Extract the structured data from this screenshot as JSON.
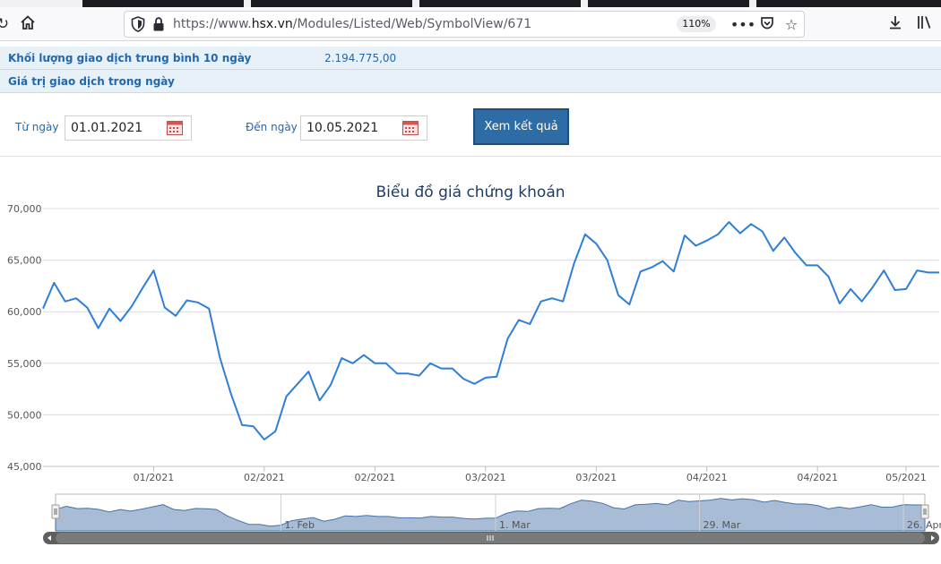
{
  "browser": {
    "url_prefix": "https://www.",
    "url_domain": "hsx.vn",
    "url_path": "/Modules/Listed/Web/SymbolView/671",
    "zoom": "110%"
  },
  "info": {
    "avg_volume_label": "Khối lượng giao dịch trung bình 10 ngày",
    "avg_volume_value": "2.194.775,00",
    "day_value_label": "Giá trị giao dịch trong ngày"
  },
  "filter": {
    "from_label": "Từ ngày",
    "from_value": "01.01.2021",
    "to_label": "Đến ngày",
    "to_value": "10.05.2021",
    "submit_label": "Xem kết quả"
  },
  "chart_data": {
    "type": "line",
    "title": "Biểu đồ giá chứng khoán",
    "ylim": [
      45000,
      70000
    ],
    "y_ticks": [
      "45,000",
      "50,000",
      "55,000",
      "60,000",
      "65,000",
      "70,000"
    ],
    "x_ticks": [
      "01/2021",
      "02/2021",
      "02/2021",
      "03/2021",
      "03/2021",
      "04/2021",
      "04/2021",
      "05/2021"
    ],
    "values": [
      60300,
      62800,
      61000,
      61300,
      60400,
      58400,
      60300,
      59100,
      60500,
      62300,
      64000,
      60400,
      59600,
      61100,
      60900,
      60300,
      55500,
      52000,
      49000,
      48900,
      47600,
      48400,
      51800,
      53000,
      54200,
      51400,
      52900,
      55500,
      55000,
      55800,
      55000,
      55000,
      54000,
      54000,
      53800,
      55000,
      54500,
      54500,
      53500,
      53000,
      53600,
      53700,
      57400,
      59200,
      58800,
      61000,
      61300,
      61000,
      64700,
      67500,
      66600,
      65000,
      61600,
      60700,
      63900,
      64300,
      64900,
      63900,
      67400,
      66400,
      66900,
      67500,
      68700,
      67600,
      68500,
      67800,
      65900,
      67200,
      65700,
      64500,
      64500,
      63400,
      60800,
      62200,
      61000,
      62400,
      64000,
      62100,
      62200,
      64000,
      63800,
      63800
    ],
    "navigator_labels": [
      "1. Feb",
      "1. Mar",
      "29. Mar",
      "26. Apr"
    ],
    "grid": true,
    "legend": "none"
  }
}
